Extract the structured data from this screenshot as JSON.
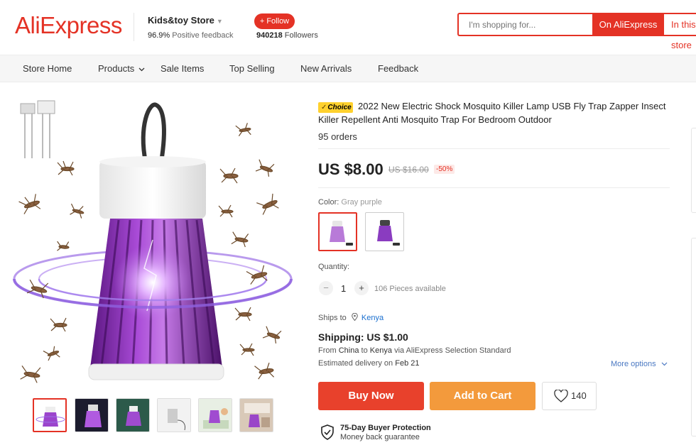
{
  "header": {
    "logo": "AliExpress",
    "store_name": "Kids&toy Store",
    "feedback_value": "96.9%",
    "feedback_label": "Positive feedback",
    "follow_label": "+ Follow",
    "followers_count": "940218",
    "followers_label": "Followers",
    "search_placeholder": "I'm shopping for...",
    "search_on_ali": "On AliExpress",
    "search_in_store": "In this store"
  },
  "nav": {
    "items": [
      "Store Home",
      "Products",
      "Sale Items",
      "Top Selling",
      "New Arrivals",
      "Feedback"
    ]
  },
  "product": {
    "badge": "Choice",
    "title": "2022 New Electric Shock Mosquito Killer Lamp USB Fly Trap Zapper Insect Killer Repellent Anti Mosquito Trap For Bedroom Outdoor",
    "orders": "95 orders",
    "price": "US $8.00",
    "original_price": "US $16.00",
    "discount": "-50%",
    "color_label": "Color:",
    "color_value": "Gray purple",
    "quantity_label": "Quantity:",
    "quantity_minus": "−",
    "quantity_value": "1",
    "quantity_plus": "+",
    "available": "106 Pieces available",
    "ships_label": "Ships to",
    "ships_country": "Kenya",
    "shipping": "Shipping: US $1.00",
    "ship_from_prefix": "From",
    "ship_from": "China",
    "ship_to_prefix": "to",
    "ship_to": "Kenya",
    "ship_via": "via AliExpress Selection Standard",
    "delivery_prefix": "Estimated delivery on",
    "delivery_date": "Feb 21",
    "more_options": "More options",
    "buy_now": "Buy Now",
    "add_to_cart": "Add to Cart",
    "wishlist_count": "140",
    "protection_title": "75-Day Buyer Protection",
    "protection_sub": "Money back guarantee"
  },
  "colors": {
    "brand": "#e43225",
    "buy": "#e8412c",
    "cart": "#f39a3c",
    "lamp_purple": "#8e2fb8",
    "link": "#1a6fcf"
  }
}
